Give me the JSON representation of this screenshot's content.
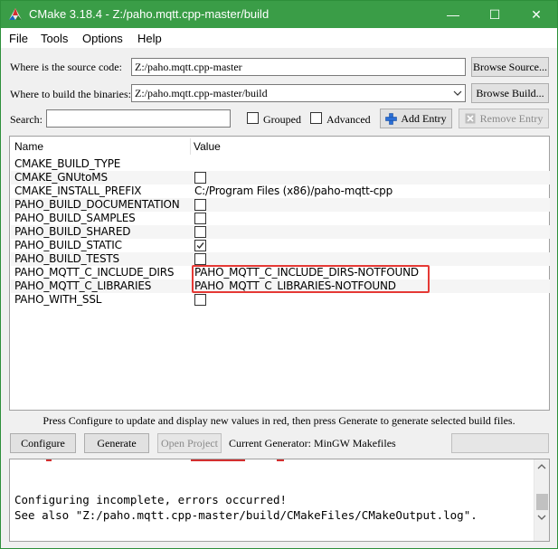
{
  "window": {
    "title": "CMake 3.18.4 - Z:/paho.mqtt.cpp-master/build",
    "minimize_glyph": "—",
    "maximize_glyph": "☐",
    "close_glyph": "✕"
  },
  "menu": [
    "File",
    "Tools",
    "Options",
    "Help"
  ],
  "source": {
    "label": "Where is the source code:",
    "value": "Z:/paho.mqtt.cpp-master",
    "browse_label": "Browse Source..."
  },
  "binaries": {
    "label": "Where to build the binaries:",
    "value": "Z:/paho.mqtt.cpp-master/build",
    "browse_label": "Browse Build..."
  },
  "search": {
    "label": "Search:",
    "value": "",
    "grouped_label": "Grouped",
    "advanced_label": "Advanced",
    "add_entry_label": "Add Entry",
    "remove_entry_label": "Remove Entry"
  },
  "table": {
    "columns": [
      "Name",
      "Value"
    ],
    "rows": [
      {
        "name": "CMAKE_BUILD_TYPE",
        "value": "",
        "type": "text"
      },
      {
        "name": "CMAKE_GNUtoMS",
        "value": "",
        "type": "bool",
        "checked": false
      },
      {
        "name": "CMAKE_INSTALL_PREFIX",
        "value": "C:/Program Files (x86)/paho-mqtt-cpp",
        "type": "text"
      },
      {
        "name": "PAHO_BUILD_DOCUMENTATION",
        "value": "",
        "type": "bool",
        "checked": false
      },
      {
        "name": "PAHO_BUILD_SAMPLES",
        "value": "",
        "type": "bool",
        "checked": false
      },
      {
        "name": "PAHO_BUILD_SHARED",
        "value": "",
        "type": "bool",
        "checked": false
      },
      {
        "name": "PAHO_BUILD_STATIC",
        "value": "",
        "type": "bool",
        "checked": true
      },
      {
        "name": "PAHO_BUILD_TESTS",
        "value": "",
        "type": "bool",
        "checked": false
      },
      {
        "name": "PAHO_MQTT_C_INCLUDE_DIRS",
        "value": "PAHO_MQTT_C_INCLUDE_DIRS-NOTFOUND",
        "type": "text"
      },
      {
        "name": "PAHO_MQTT_C_LIBRARIES",
        "value": "PAHO_MQTT_C_LIBRARIES-NOTFOUND",
        "type": "text"
      },
      {
        "name": "PAHO_WITH_SSL",
        "value": "",
        "type": "bool",
        "checked": false
      }
    ]
  },
  "hint": "Press Configure to update and display new values in red, then press Generate to generate selected build files.",
  "actions": {
    "configure_label": "Configure",
    "generate_label": "Generate",
    "open_project_label": "Open Project",
    "generator_text": "Current Generator: MinGW Makefiles"
  },
  "log": {
    "lines": [
      "Configuring incomplete, errors occurred!",
      "See also \"Z:/paho.mqtt.cpp-master/build/CMakeFiles/CMakeOutput.log\"."
    ]
  },
  "colors": {
    "titlebar": "#3a9d47",
    "highlight": "#e53935",
    "add_icon": "#2b6fd6"
  }
}
